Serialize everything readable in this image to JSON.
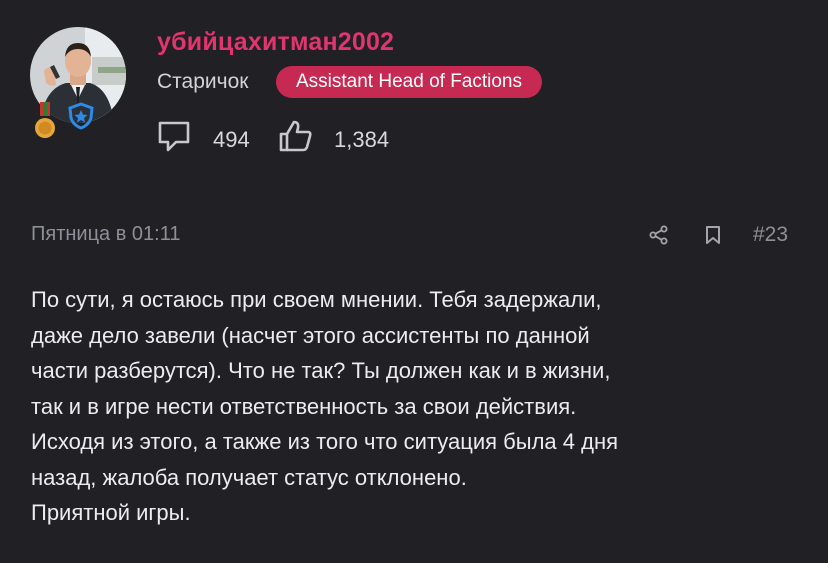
{
  "author": {
    "username": "убийцахитман2002",
    "rank": "Старичок",
    "role": "Assistant Head of Factions",
    "messages_count": "494",
    "reactions_count": "1,384",
    "avatar_icon": "user-avatar-photo",
    "badges": [
      "medal-icon",
      "shield-star-icon"
    ]
  },
  "post": {
    "date": "Пятница в 01:11",
    "number": "#23",
    "lines": [
      "По сути, я остаюсь при своем мнении. Тебя задержали,",
      "даже дело завели (насчет этого ассистенты по данной",
      "части разберутся). Что не так? Ты должен как и в жизни,",
      "так и в игре нести ответственность за свои действия.",
      "Исходя из этого, а также из того что ситуация была 4 дня",
      "назад, жалоба получает статус отклонено.",
      "Приятной игры."
    ]
  },
  "colors": {
    "background": "#202025",
    "username": "#e0356d",
    "role_pill": "#c62a52",
    "muted": "#8f8f98"
  }
}
